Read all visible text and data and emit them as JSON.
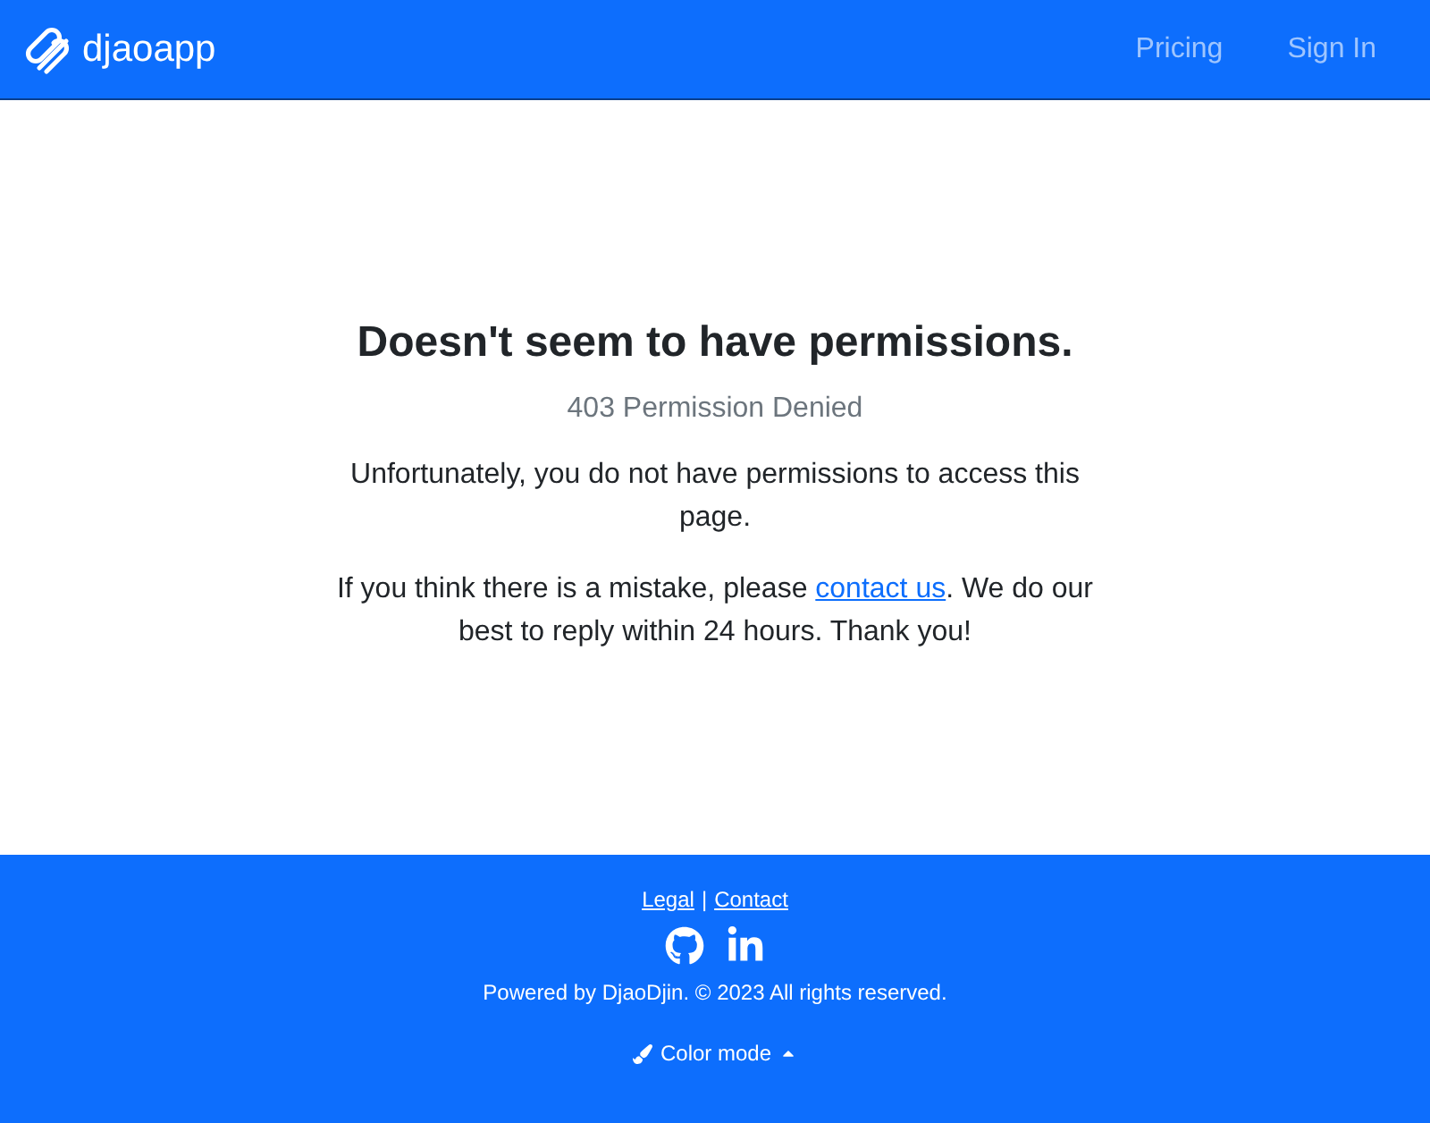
{
  "brand": "djaoapp",
  "nav": [
    "Pricing",
    "Sign In"
  ],
  "title": "Doesn't seem to have permissions.",
  "subtitle": "403 Permission Denied",
  "message": "Unfortunately, you do not have permissions to access this page.",
  "contact": {
    "before": "If you think there is a mistake, please ",
    "link": "contact us",
    "after": ". We do our best to reply within 24 hours. Thank you!"
  },
  "footer": {
    "links": [
      "Legal",
      "Contact"
    ],
    "separator": "|",
    "powered": "Powered by DjaoDjin. © 2023 All rights reserved.",
    "color_mode": "Color mode"
  }
}
